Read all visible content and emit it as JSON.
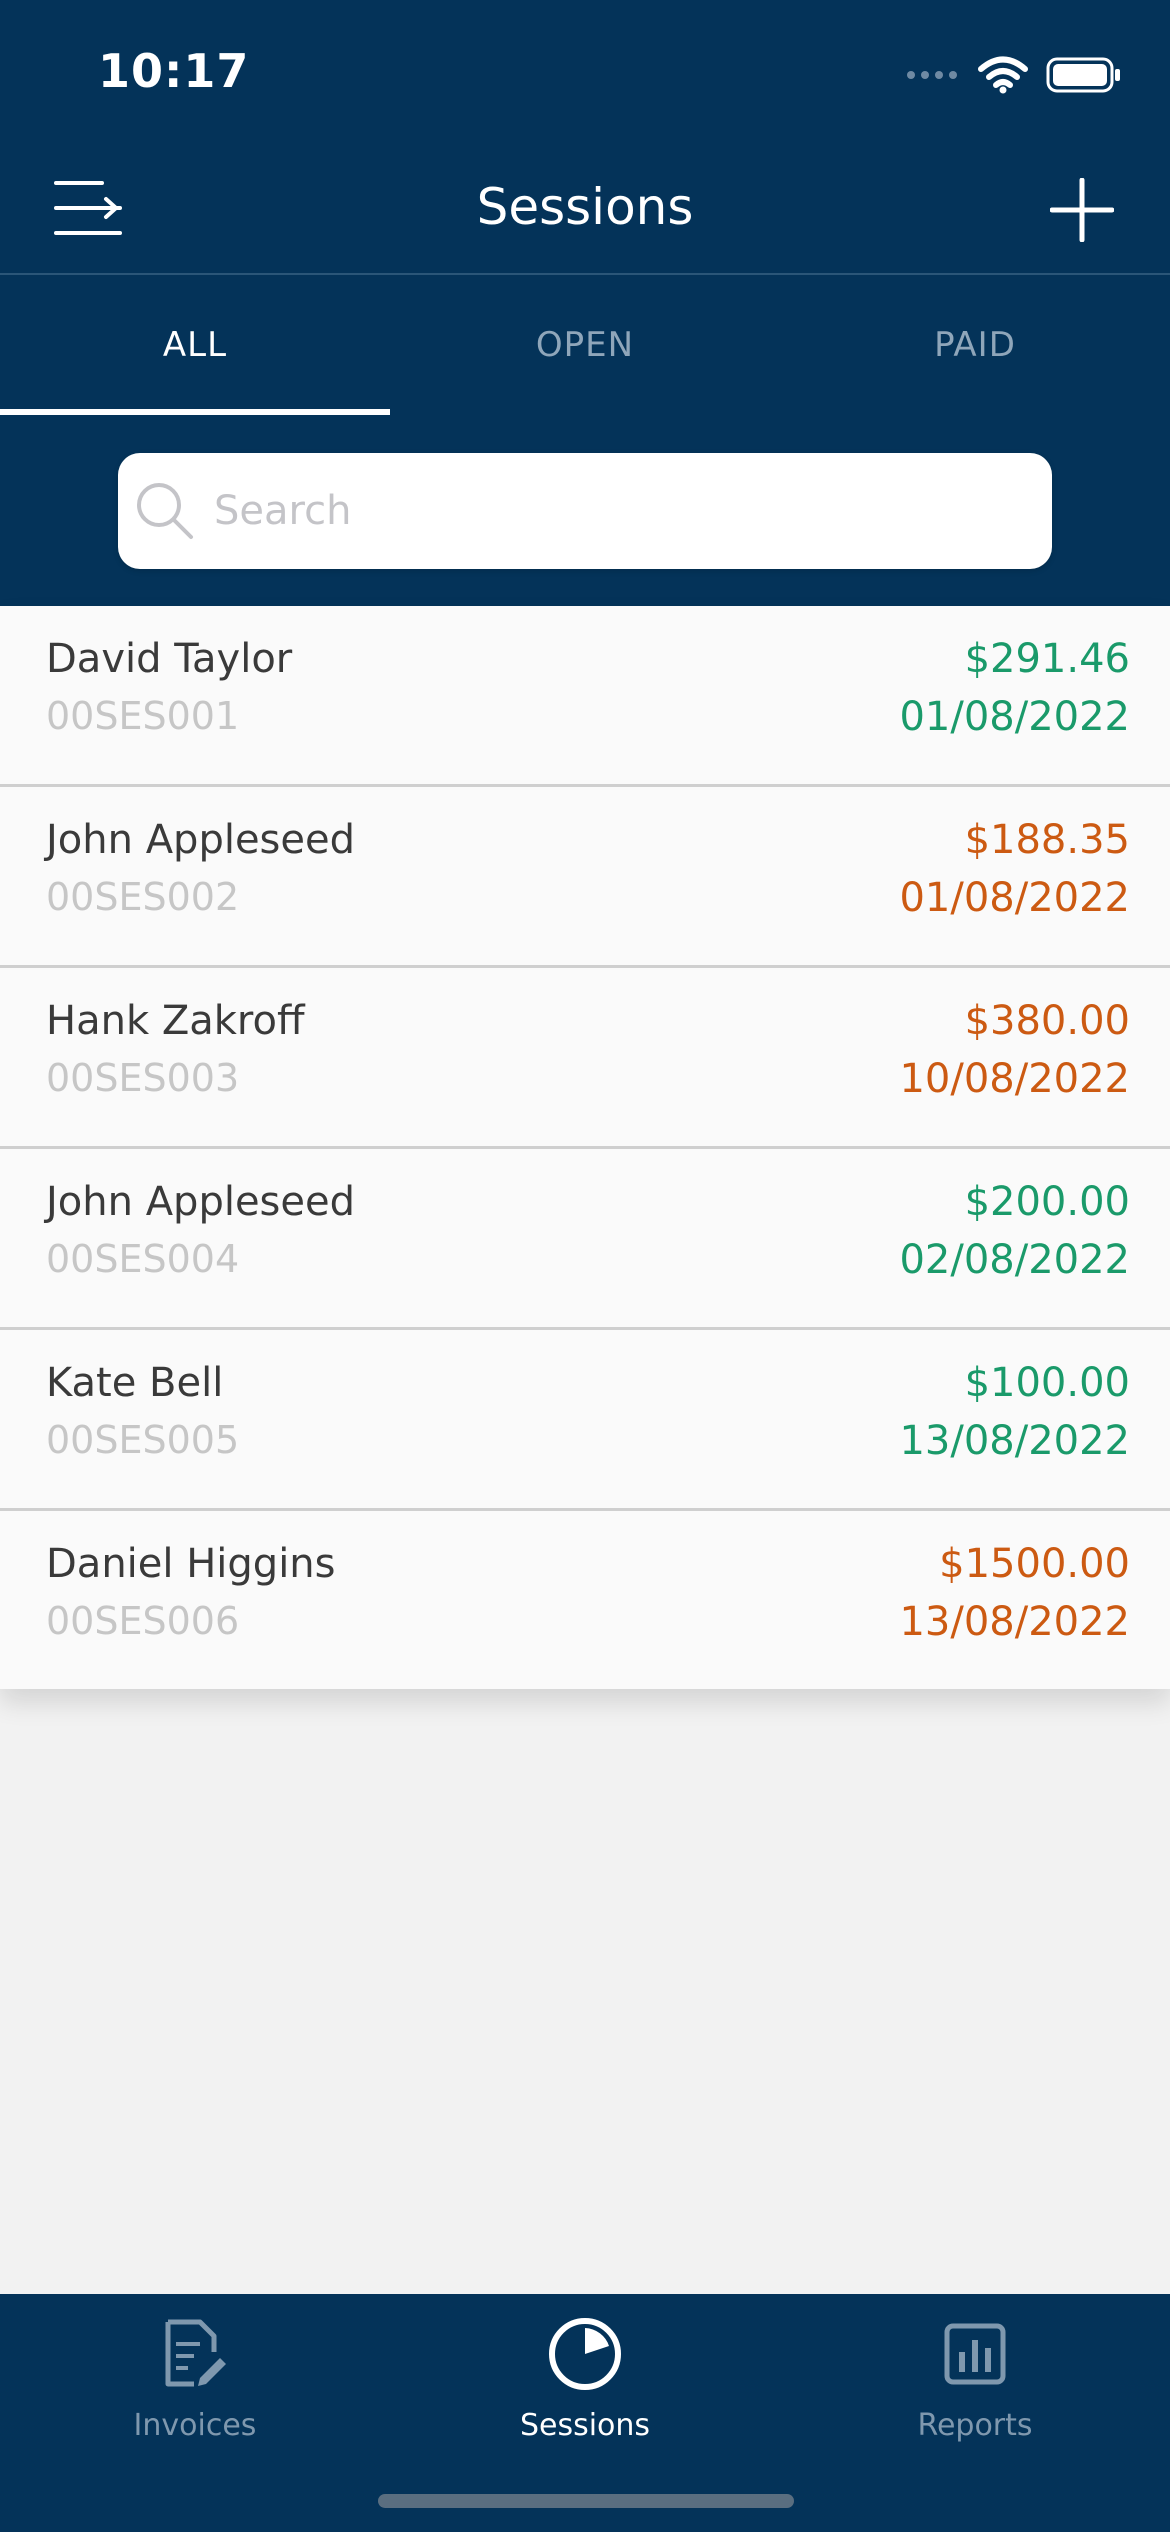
{
  "status_bar": {
    "time": "10:17"
  },
  "nav": {
    "title": "Sessions",
    "menu_icon": "menu-icon",
    "add_icon": "plus-icon"
  },
  "tabs": [
    {
      "label": "ALL",
      "active": true
    },
    {
      "label": "OPEN",
      "active": false
    },
    {
      "label": "PAID",
      "active": false
    }
  ],
  "search": {
    "placeholder": "Search",
    "value": ""
  },
  "sessions": [
    {
      "name": "David Taylor",
      "id": "00SES001",
      "amount": "$291.46",
      "date": "01/08/2022",
      "status": "paid"
    },
    {
      "name": "John Appleseed",
      "id": "00SES002",
      "amount": "$188.35",
      "date": "01/08/2022",
      "status": "open"
    },
    {
      "name": "Hank Zakroff",
      "id": "00SES003",
      "amount": "$380.00",
      "date": "10/08/2022",
      "status": "open"
    },
    {
      "name": "John Appleseed",
      "id": "00SES004",
      "amount": "$200.00",
      "date": "02/08/2022",
      "status": "paid"
    },
    {
      "name": "Kate Bell",
      "id": "00SES005",
      "amount": "$100.00",
      "date": "13/08/2022",
      "status": "paid"
    },
    {
      "name": "Daniel Higgins",
      "id": "00SES006",
      "amount": "$1500.00",
      "date": "13/08/2022",
      "status": "open"
    }
  ],
  "tabbar": [
    {
      "label": "Invoices",
      "icon": "invoice-icon",
      "active": false
    },
    {
      "label": "Sessions",
      "icon": "sessions-icon",
      "active": true
    },
    {
      "label": "Reports",
      "icon": "reports-icon",
      "active": false
    }
  ],
  "colors": {
    "header_bg": "#043359",
    "paid": "#1a9a6a",
    "open": "#cc5a12"
  }
}
